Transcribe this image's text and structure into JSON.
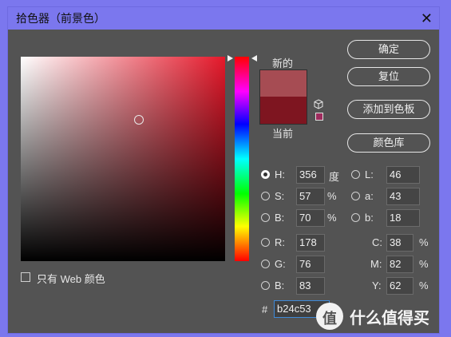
{
  "window": {
    "title": "拾色器（前景色）",
    "close_glyph": "✕"
  },
  "swatch": {
    "new_label": "新的",
    "current_label": "当前",
    "new_color": "#a64c53",
    "current_color": "#7e1520"
  },
  "buttons": {
    "ok": "确定",
    "reset": "复位",
    "add_to_swatches": "添加到色板",
    "color_libraries": "颜色库"
  },
  "hsb": {
    "h_label": "H:",
    "h_value": "356",
    "h_unit": "度",
    "s_label": "S:",
    "s_value": "57",
    "s_unit": "%",
    "b_label": "B:",
    "b_value": "70",
    "b_unit": "%"
  },
  "lab": {
    "l_label": "L:",
    "l_value": "46",
    "a_label": "a:",
    "a_value": "43",
    "b_label": "b:",
    "b_value": "18"
  },
  "rgb": {
    "r_label": "R:",
    "r_value": "178",
    "g_label": "G:",
    "g_value": "76",
    "b_label": "B:",
    "b_value": "83"
  },
  "cmyk": {
    "c_label": "C:",
    "c_value": "38",
    "c_unit": "%",
    "m_label": "M:",
    "m_value": "82",
    "m_unit": "%",
    "y_label": "Y:",
    "y_value": "62",
    "y_unit": "%"
  },
  "hex": {
    "label": "#",
    "value": "b24c53"
  },
  "web_only": {
    "label": "只有 Web 颜色"
  },
  "watermark": {
    "text": "值 | 什么值得买",
    "glyph": "值",
    "brand": "什么值得买"
  },
  "colors": {
    "accent": "#7b77ee",
    "panel": "#535353"
  }
}
